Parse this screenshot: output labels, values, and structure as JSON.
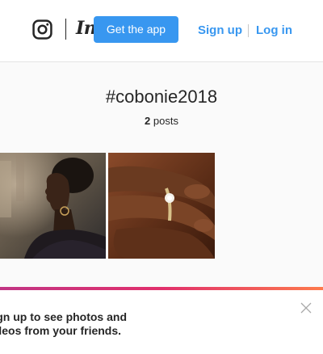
{
  "header": {
    "logo_icon": "instagram-camera-icon",
    "wordmark": "Instagram",
    "get_app_label": "Get the app",
    "signup_label": "Sign up",
    "login_label": "Log in",
    "accent_color": "#3897f0"
  },
  "hashtag": {
    "title": "#cobonie2018",
    "post_count": "2",
    "post_count_unit": "posts"
  },
  "posts": [
    {
      "kind": "photo",
      "subject": "woman-profile-portrait"
    },
    {
      "kind": "photo",
      "subject": "engagement-ring-hand"
    }
  ],
  "banner": {
    "message_line1": "Sign up to see photos and",
    "message_line2": "videos from your friends.",
    "close_icon": "close-icon",
    "gradient": [
      "#c13584",
      "#e1306c",
      "#fd7a4c"
    ]
  }
}
